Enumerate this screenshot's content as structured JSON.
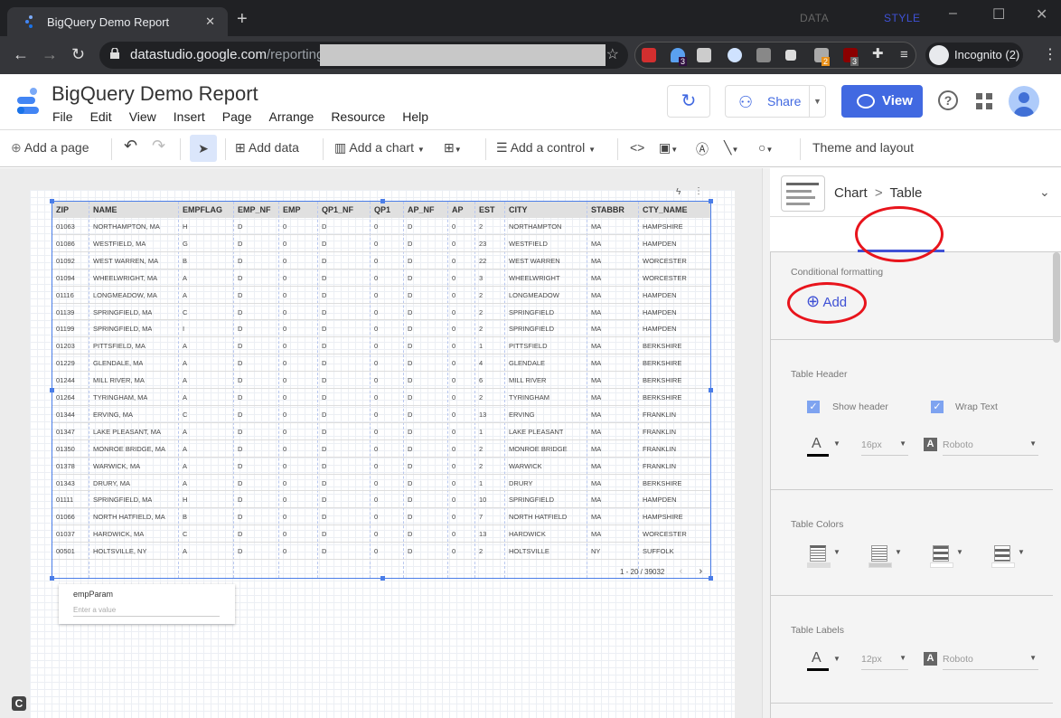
{
  "browser": {
    "tab_title": "BigQuery Demo Report",
    "url_domain": "datastudio.google.com",
    "url_path": "/reporting/",
    "profile": "Incognito (2)",
    "extension_badges": [
      "3",
      "2",
      "3"
    ]
  },
  "app": {
    "title": "BigQuery Demo Report",
    "menu": [
      "File",
      "Edit",
      "View",
      "Insert",
      "Page",
      "Arrange",
      "Resource",
      "Help"
    ],
    "share_label": "Share",
    "view_label": "View",
    "help_label": "?"
  },
  "toolbar": {
    "add_page": "Add a page",
    "add_data": "Add data",
    "add_chart": "Add a chart",
    "add_control": "Add a control",
    "code_label": "<>",
    "theme_layout": "Theme and layout"
  },
  "table": {
    "columns": [
      "ZIP",
      "NAME",
      "EMPFLAG",
      "EMP_NF",
      "EMP",
      "QP1_NF",
      "QP1",
      "AP_NF",
      "AP",
      "EST",
      "CITY",
      "STABBR",
      "CTY_NAME"
    ],
    "rows": [
      [
        "01063",
        "NORTHAMPTON, MA",
        "H",
        "D",
        "0",
        "D",
        "0",
        "D",
        "0",
        "2",
        "NORTHAMPTON",
        "MA",
        "HAMPSHIRE"
      ],
      [
        "01086",
        "WESTFIELD, MA",
        "G",
        "D",
        "0",
        "D",
        "0",
        "D",
        "0",
        "23",
        "WESTFIELD",
        "MA",
        "HAMPDEN"
      ],
      [
        "01092",
        "WEST WARREN, MA",
        "B",
        "D",
        "0",
        "D",
        "0",
        "D",
        "0",
        "22",
        "WEST WARREN",
        "MA",
        "WORCESTER"
      ],
      [
        "01094",
        "WHEELWRIGHT, MA",
        "A",
        "D",
        "0",
        "D",
        "0",
        "D",
        "0",
        "3",
        "WHEELWRIGHT",
        "MA",
        "WORCESTER"
      ],
      [
        "01116",
        "LONGMEADOW, MA",
        "A",
        "D",
        "0",
        "D",
        "0",
        "D",
        "0",
        "2",
        "LONGMEADOW",
        "MA",
        "HAMPDEN"
      ],
      [
        "01139",
        "SPRINGFIELD, MA",
        "C",
        "D",
        "0",
        "D",
        "0",
        "D",
        "0",
        "2",
        "SPRINGFIELD",
        "MA",
        "HAMPDEN"
      ],
      [
        "01199",
        "SPRINGFIELD, MA",
        "I",
        "D",
        "0",
        "D",
        "0",
        "D",
        "0",
        "2",
        "SPRINGFIELD",
        "MA",
        "HAMPDEN"
      ],
      [
        "01203",
        "PITTSFIELD, MA",
        "A",
        "D",
        "0",
        "D",
        "0",
        "D",
        "0",
        "1",
        "PITTSFIELD",
        "MA",
        "BERKSHIRE"
      ],
      [
        "01229",
        "GLENDALE, MA",
        "A",
        "D",
        "0",
        "D",
        "0",
        "D",
        "0",
        "4",
        "GLENDALE",
        "MA",
        "BERKSHIRE"
      ],
      [
        "01244",
        "MILL RIVER, MA",
        "A",
        "D",
        "0",
        "D",
        "0",
        "D",
        "0",
        "6",
        "MILL RIVER",
        "MA",
        "BERKSHIRE"
      ],
      [
        "01264",
        "TYRINGHAM, MA",
        "A",
        "D",
        "0",
        "D",
        "0",
        "D",
        "0",
        "2",
        "TYRINGHAM",
        "MA",
        "BERKSHIRE"
      ],
      [
        "01344",
        "ERVING, MA",
        "C",
        "D",
        "0",
        "D",
        "0",
        "D",
        "0",
        "13",
        "ERVING",
        "MA",
        "FRANKLIN"
      ],
      [
        "01347",
        "LAKE PLEASANT, MA",
        "A",
        "D",
        "0",
        "D",
        "0",
        "D",
        "0",
        "1",
        "LAKE PLEASANT",
        "MA",
        "FRANKLIN"
      ],
      [
        "01350",
        "MONROE BRIDGE, MA",
        "A",
        "D",
        "0",
        "D",
        "0",
        "D",
        "0",
        "2",
        "MONROE BRIDGE",
        "MA",
        "FRANKLIN"
      ],
      [
        "01378",
        "WARWICK, MA",
        "A",
        "D",
        "0",
        "D",
        "0",
        "D",
        "0",
        "2",
        "WARWICK",
        "MA",
        "FRANKLIN"
      ],
      [
        "01343",
        "DRURY, MA",
        "A",
        "D",
        "0",
        "D",
        "0",
        "D",
        "0",
        "1",
        "DRURY",
        "MA",
        "BERKSHIRE"
      ],
      [
        "01111",
        "SPRINGFIELD, MA",
        "H",
        "D",
        "0",
        "D",
        "0",
        "D",
        "0",
        "10",
        "SPRINGFIELD",
        "MA",
        "HAMPDEN"
      ],
      [
        "01066",
        "NORTH HATFIELD, MA",
        "B",
        "D",
        "0",
        "D",
        "0",
        "D",
        "0",
        "7",
        "NORTH HATFIELD",
        "MA",
        "HAMPSHIRE"
      ],
      [
        "01037",
        "HARDWICK, MA",
        "C",
        "D",
        "0",
        "D",
        "0",
        "D",
        "0",
        "13",
        "HARDWICK",
        "MA",
        "WORCESTER"
      ],
      [
        "00501",
        "HOLTSVILLE, NY",
        "A",
        "D",
        "0",
        "D",
        "0",
        "D",
        "0",
        "2",
        "HOLTSVILLE",
        "NY",
        "SUFFOLK"
      ]
    ],
    "pagination": "1 - 20 / 39032"
  },
  "control": {
    "label": "empParam",
    "placeholder": "Enter a value"
  },
  "panel": {
    "breadcrumb_chart": "Chart",
    "breadcrumb_sep": ">",
    "breadcrumb_table": "Table",
    "tabs": [
      "DATA",
      "STYLE"
    ],
    "conditional_formatting": "Conditional formatting",
    "add_label": "Add",
    "table_header": "Table Header",
    "show_header": "Show header",
    "wrap_text": "Wrap Text",
    "header_font_size": "16px",
    "header_font": "Roboto",
    "table_colors": "Table Colors",
    "table_labels": "Table Labels",
    "labels_font_size": "12px",
    "labels_font": "Roboto",
    "font_icon_letter": "A"
  },
  "colors": {
    "accent": "#4169e1",
    "annotation": "#e8141c",
    "selection": "#4a7de8"
  }
}
